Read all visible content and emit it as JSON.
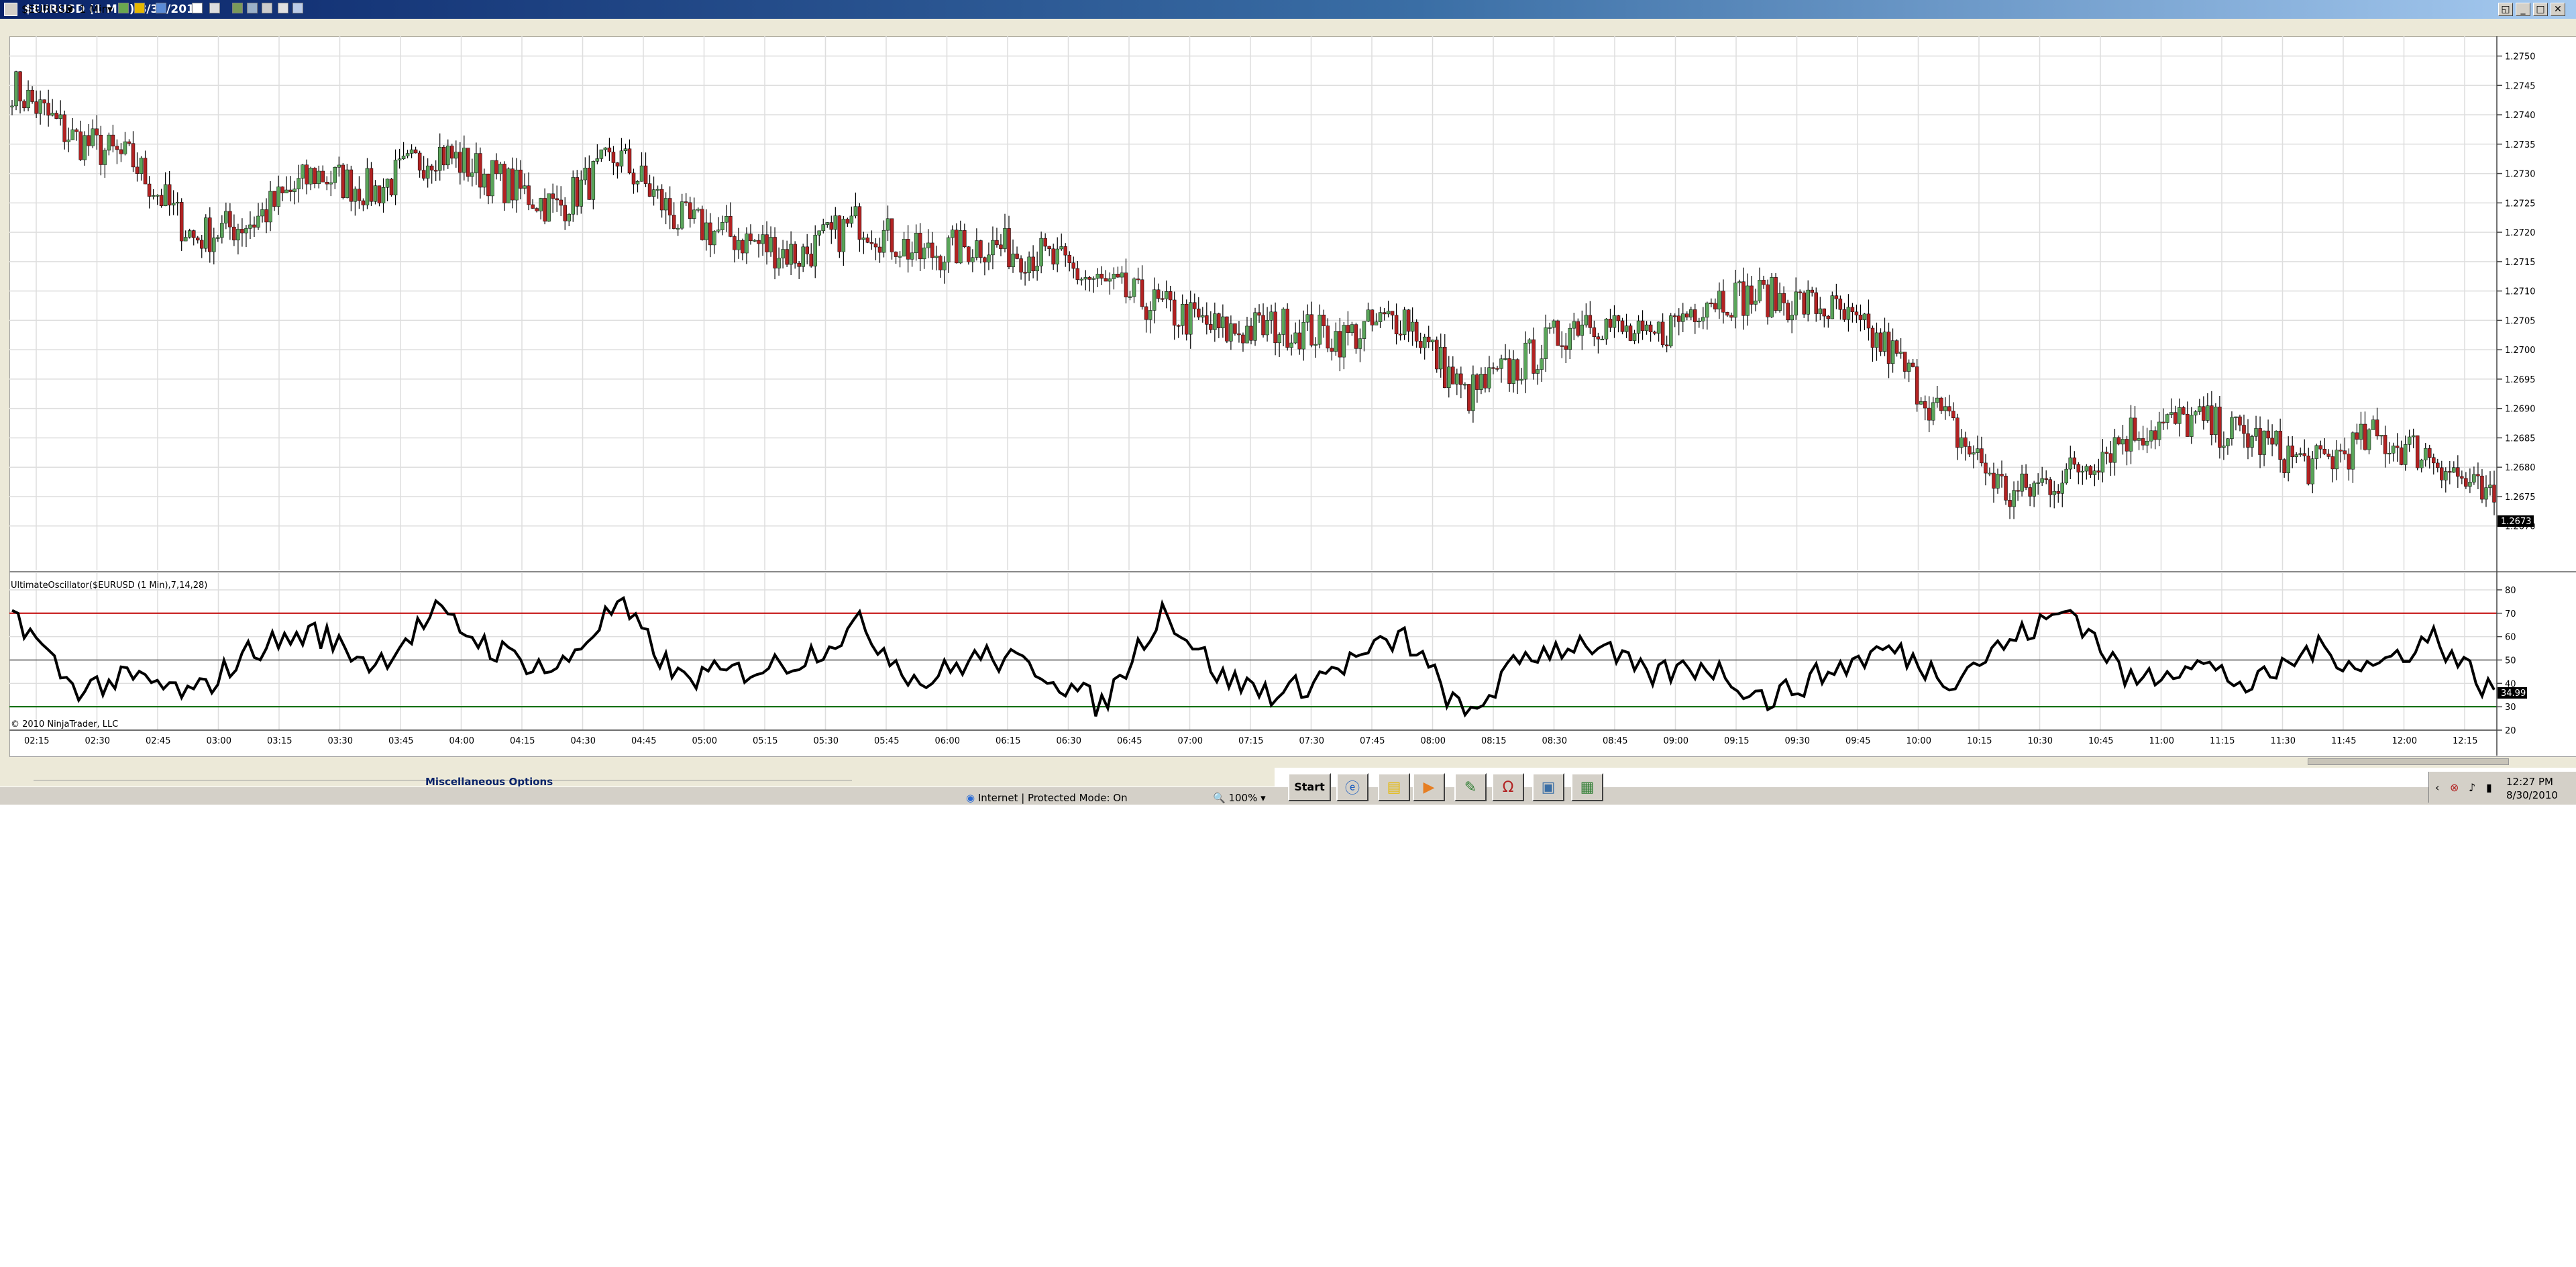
{
  "window": {
    "title": "$EURUSD (1 Min)  8/30/2010"
  },
  "toolbar": {
    "instrument": "$EURUSD",
    "interval": "1 Min"
  },
  "price_panel": {
    "last_price": "1.2673",
    "axis_labels": [
      "1.2750",
      "1.2745",
      "1.2740",
      "1.2735",
      "1.2730",
      "1.2725",
      "1.2720",
      "1.2715",
      "1.2710",
      "1.2705",
      "1.2700",
      "1.2695",
      "1.2690",
      "1.2685",
      "1.2680",
      "1.2675",
      "1.2670"
    ]
  },
  "oscillator_panel": {
    "title": "UltimateOscillator($EURUSD (1 Min),7,14,28)",
    "last_value": "34.99",
    "axis_labels": [
      "80",
      "70",
      "60",
      "50",
      "40",
      "30",
      "20"
    ],
    "copyright": "© 2010 NinjaTrader, LLC"
  },
  "time_axis": {
    "labels": [
      "02:15",
      "02:30",
      "02:45",
      "03:00",
      "03:15",
      "03:30",
      "03:45",
      "04:00",
      "04:15",
      "04:30",
      "04:45",
      "05:00",
      "05:15",
      "05:30",
      "05:45",
      "06:00",
      "06:15",
      "06:30",
      "06:45",
      "07:00",
      "07:15",
      "07:30",
      "07:45",
      "08:00",
      "08:15",
      "08:30",
      "08:45",
      "09:00",
      "09:15",
      "09:30",
      "09:45",
      "10:00",
      "10:15",
      "10:30",
      "10:45",
      "11:00",
      "11:15",
      "11:30",
      "11:45",
      "12:00",
      "12:15"
    ]
  },
  "properties": {
    "section": "Miscellaneous Options"
  },
  "browser_status": {
    "zone": "Internet | Protected Mode: On",
    "zoom": "100%"
  },
  "taskbar": {
    "start_label": "Start",
    "clock_time": "12:27 PM",
    "clock_date": "8/30/2010"
  },
  "colors": {
    "up_candle": "#5aa55a",
    "down_candle": "#b22222",
    "overbought_line": "#c00000",
    "oversold_line": "#006400",
    "osc_line": "#000000"
  },
  "chart_data": [
    {
      "type": "candlestick",
      "x": [
        "02:15",
        "02:30",
        "02:45",
        "03:00",
        "03:15",
        "03:30",
        "03:45",
        "04:00",
        "04:15",
        "04:30",
        "04:45",
        "05:00",
        "05:15",
        "05:30",
        "05:45",
        "06:00",
        "06:15",
        "06:30",
        "06:45",
        "07:00",
        "07:15",
        "07:30",
        "07:45",
        "08:00",
        "08:15",
        "08:30",
        "08:45",
        "09:00",
        "09:15",
        "09:30",
        "09:45",
        "10:00",
        "10:15",
        "10:30",
        "10:45",
        "11:00",
        "11:15",
        "11:30",
        "11:45",
        "12:00",
        "12:15",
        "12:24"
      ],
      "close": [
        1.2745,
        1.2736,
        1.2732,
        1.2719,
        1.2722,
        1.273,
        1.2727,
        1.2734,
        1.2729,
        1.2724,
        1.2733,
        1.2722,
        1.2719,
        1.2716,
        1.2722,
        1.2716,
        1.2718,
        1.2716,
        1.2711,
        1.2707,
        1.2703,
        1.2704,
        1.2702,
        1.2706,
        1.2692,
        1.2698,
        1.2706,
        1.2701,
        1.2709,
        1.2709,
        1.2707,
        1.27,
        1.2687,
        1.2675,
        1.2679,
        1.2686,
        1.2688,
        1.2685,
        1.268,
        1.2685,
        1.2682,
        1.2673
      ],
      "ylim": [
        1.2667,
        1.2752
      ]
    },
    {
      "type": "line",
      "series": [
        {
          "name": "UltimateOscillator($EURUSD (1 Min),7,14,28)",
          "values": [
            72,
            38,
            42,
            35,
            55,
            62,
            48,
            70,
            54,
            45,
            74,
            42,
            45,
            50,
            65,
            40,
            52,
            46,
            30,
            72,
            42,
            35,
            48,
            60,
            25,
            52,
            58,
            43,
            48,
            33,
            45,
            55,
            42,
            58,
            72,
            40,
            50,
            38,
            55,
            47,
            60,
            35
          ]
        }
      ],
      "x": [
        "02:15",
        "02:30",
        "02:45",
        "03:00",
        "03:15",
        "03:30",
        "03:45",
        "04:00",
        "04:15",
        "04:30",
        "04:45",
        "05:00",
        "05:15",
        "05:30",
        "05:45",
        "06:00",
        "06:15",
        "06:30",
        "06:45",
        "07:00",
        "07:15",
        "07:30",
        "07:45",
        "08:00",
        "08:15",
        "08:30",
        "08:45",
        "09:00",
        "09:15",
        "09:30",
        "09:45",
        "10:00",
        "10:15",
        "10:30",
        "10:45",
        "11:00",
        "11:15",
        "11:30",
        "11:45",
        "12:00",
        "12:15",
        "12:24"
      ],
      "ylim": [
        20,
        82
      ],
      "reference_lines": [
        70,
        50,
        30
      ]
    }
  ]
}
